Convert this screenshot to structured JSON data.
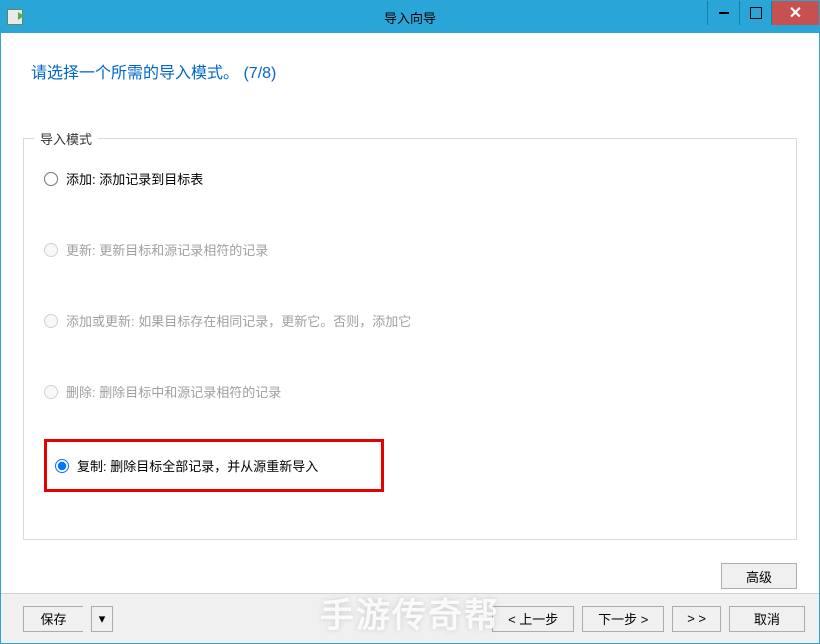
{
  "window": {
    "title": "导入向导"
  },
  "heading": {
    "text": "请选择一个所需的导入模式。",
    "step": "(7/8)"
  },
  "group": {
    "legend": "导入模式",
    "options": {
      "add": "添加: 添加记录到目标表",
      "update": "更新: 更新目标和源记录相符的记录",
      "add_or_update": "添加或更新: 如果目标存在相同记录，更新它。否则，添加它",
      "delete": "删除: 删除目标中和源记录相符的记录",
      "copy": "复制: 删除目标全部记录，并从源重新导入"
    }
  },
  "buttons": {
    "advanced": "高级",
    "save": "保存",
    "prev": "< 上一步",
    "next": "下一步 >",
    "jump": ">  >",
    "cancel": "取消"
  },
  "watermark": "手游传奇帮"
}
